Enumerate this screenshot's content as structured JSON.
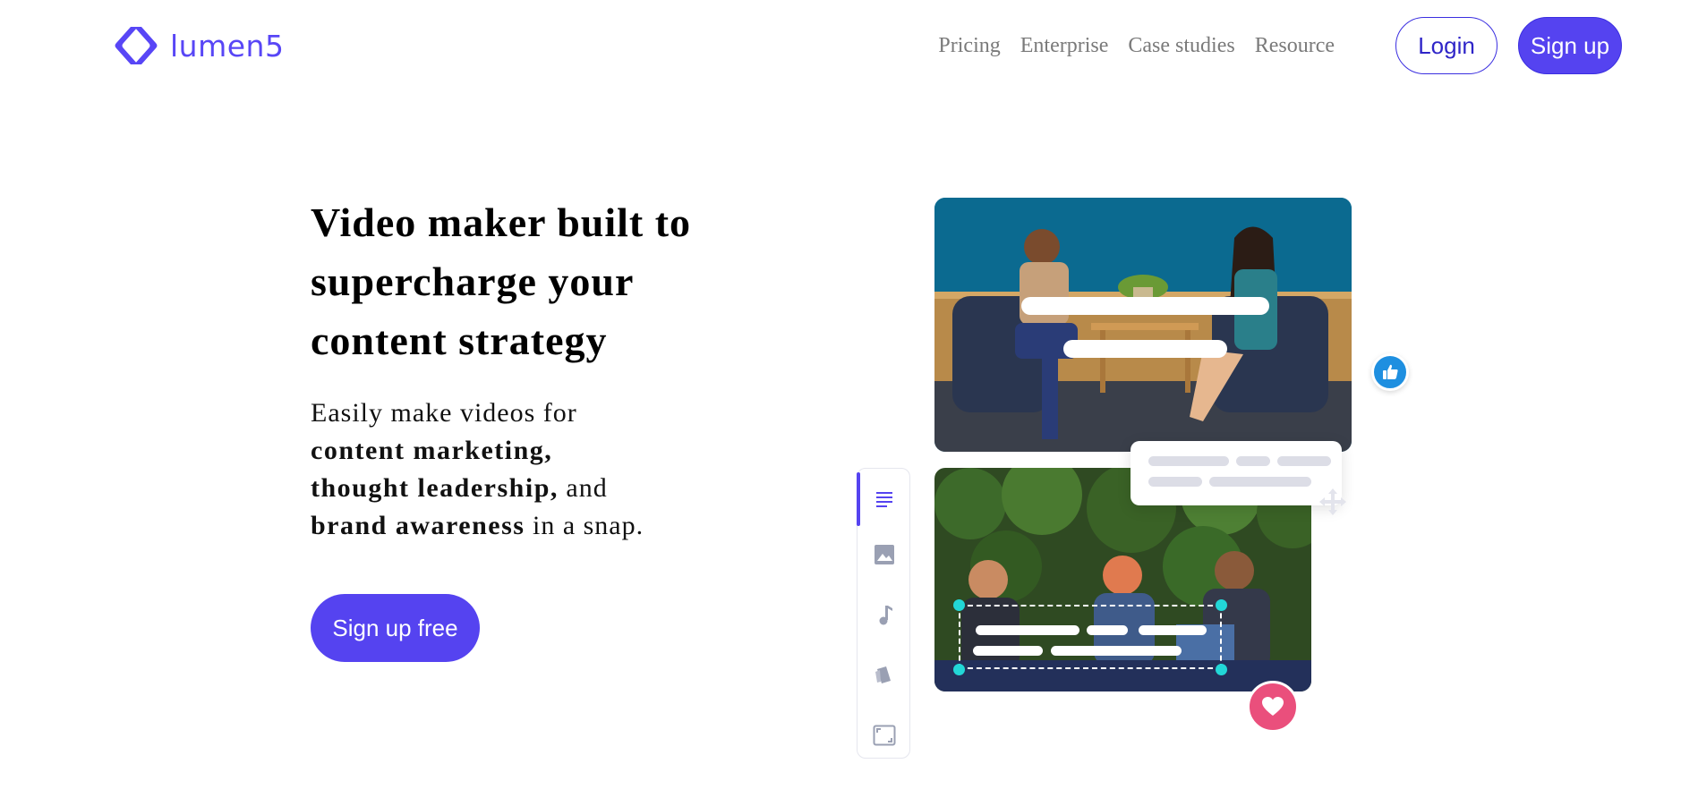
{
  "brand": {
    "name": "lumen5",
    "color": "#5543f0",
    "logo_icon": "lumen5-logo-icon"
  },
  "nav": {
    "links": [
      {
        "label": "Pricing"
      },
      {
        "label": "Enterprise"
      },
      {
        "label": "Case studies"
      },
      {
        "label": "Resource"
      }
    ],
    "login_label": "Login",
    "signup_label": "Sign up"
  },
  "hero": {
    "title": "Video maker built to supercharge your content strategy",
    "desc": {
      "intro": "Easily make videos for",
      "item1": "content marketing,",
      "item2": "thought leadership,",
      "and": "and",
      "item3": "brand awareness",
      "outro": "in a snap."
    },
    "cta_label": "Sign up free"
  },
  "illustration": {
    "side_tools": [
      {
        "icon": "text-lines-icon",
        "active": true
      },
      {
        "icon": "image-icon",
        "active": false
      },
      {
        "icon": "music-note-icon",
        "active": false
      },
      {
        "icon": "brand-cards-icon",
        "active": false
      },
      {
        "icon": "aspect-ratio-icon",
        "active": false
      }
    ],
    "badges": {
      "like_icon": "thumbs-up-icon",
      "heart_icon": "heart-icon",
      "move_icon": "move-arrows-icon"
    },
    "colors": {
      "like": "#1e8fe0",
      "heart": "#ea4f7c",
      "handle": "#22d7d7"
    }
  }
}
